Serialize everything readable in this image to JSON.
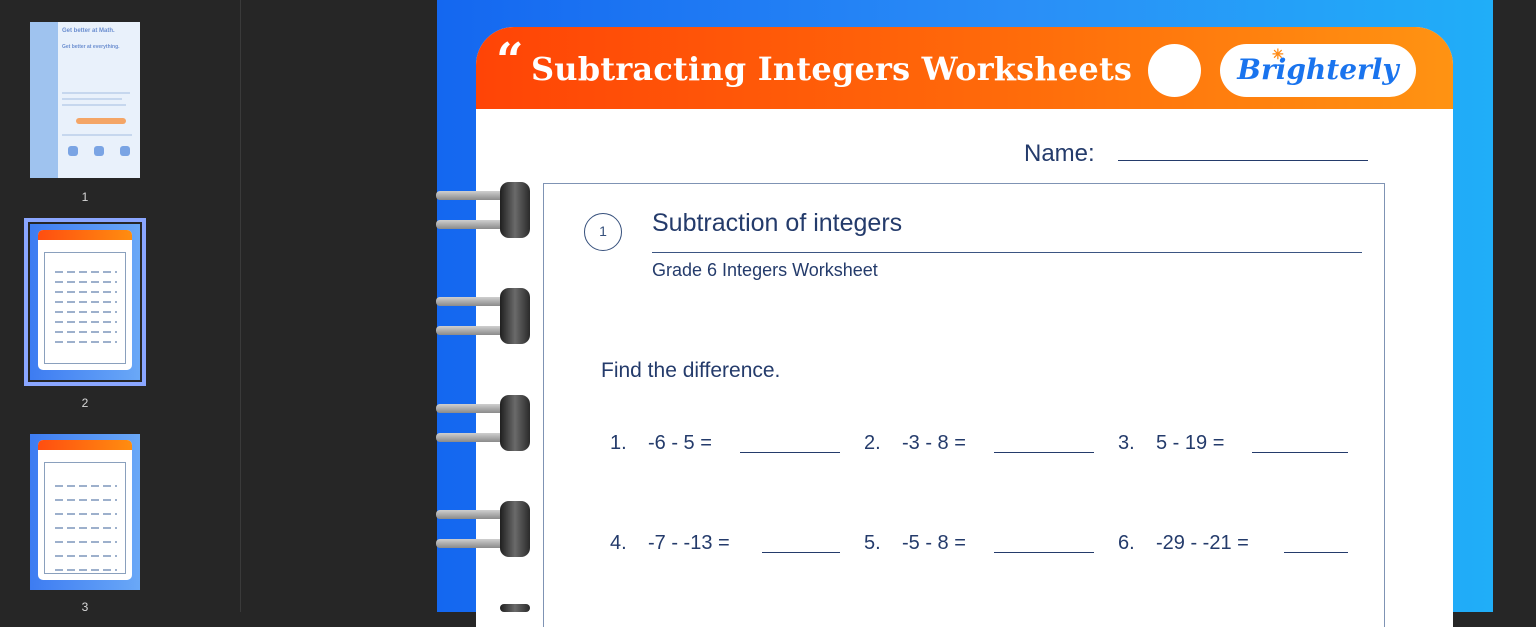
{
  "sidebar": {
    "thumbnails": [
      {
        "page_number": "1",
        "heading": "Get better at Math.",
        "subheading": "Get better at everything."
      },
      {
        "page_number": "2"
      },
      {
        "page_number": "3"
      }
    ],
    "selected_index": 1
  },
  "worksheet": {
    "quote_mark": "“",
    "title": "Subtracting Integers Worksheets",
    "logo": "Brighterly",
    "name_label": "Name:",
    "section_number": "1",
    "section_title": "Subtraction of integers",
    "section_subtitle": "Grade 6 Integers Worksheet",
    "instruction": "Find the difference.",
    "questions": [
      {
        "num": "1.",
        "expr": "-6  -  5  ="
      },
      {
        "num": "2.",
        "expr": "-3  -  8  ="
      },
      {
        "num": "3.",
        "expr": "5  -  19  ="
      },
      {
        "num": "4.",
        "expr": "-7  -  -13  ="
      },
      {
        "num": "5.",
        "expr": "-5  -  8  ="
      },
      {
        "num": "6.",
        "expr": "-29  -  -21  ="
      }
    ]
  },
  "colors": {
    "banner_start": "#ff4406",
    "banner_end": "#ff9312",
    "page_blue": "#1467f0",
    "text_navy": "#243b6b",
    "selection": "#8aa6ff"
  }
}
